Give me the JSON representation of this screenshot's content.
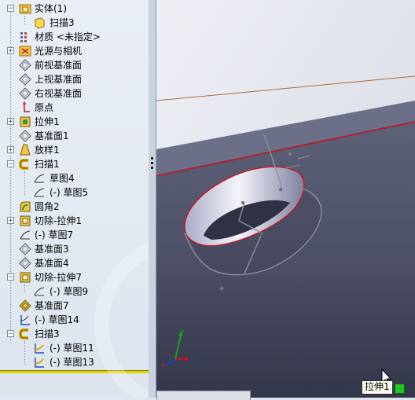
{
  "feature_tree": {
    "items": [
      {
        "label": "实体(1)",
        "icon": "solid-bodies-folder-icon",
        "expander": "−"
      },
      {
        "label": "扫描3",
        "icon": "solid-body-icon",
        "expander": ""
      },
      {
        "label": "材质 <未指定>",
        "icon": "material-icon",
        "expander": ""
      },
      {
        "label": "光源与相机",
        "icon": "lights-cameras-icon",
        "expander": "+"
      },
      {
        "label": "前视基准面",
        "icon": "plane-icon",
        "expander": ""
      },
      {
        "label": "上视基准面",
        "icon": "plane-icon",
        "expander": ""
      },
      {
        "label": "右视基准面",
        "icon": "plane-icon",
        "expander": ""
      },
      {
        "label": "原点",
        "icon": "origin-icon",
        "expander": ""
      },
      {
        "label": "拉伸1",
        "icon": "extrude-icon",
        "expander": "+"
      },
      {
        "label": "基准面1",
        "icon": "plane-icon",
        "expander": ""
      },
      {
        "label": "放样1",
        "icon": "loft-icon",
        "expander": "+"
      },
      {
        "label": "扫描1",
        "icon": "sweep-icon",
        "expander": "−"
      },
      {
        "label": "草图4",
        "icon": "sketch-icon",
        "expander": ""
      },
      {
        "label": "(-) 草图5",
        "icon": "sketch-icon",
        "expander": ""
      },
      {
        "label": "圆角2",
        "icon": "fillet-icon",
        "expander": ""
      },
      {
        "label": "切除-拉伸1",
        "icon": "cut-extrude-icon",
        "expander": "+"
      },
      {
        "label": "(-) 草图7",
        "icon": "sketch-icon",
        "expander": ""
      },
      {
        "label": "基准面3",
        "icon": "plane-icon",
        "expander": ""
      },
      {
        "label": "基准面4",
        "icon": "plane-icon",
        "expander": ""
      },
      {
        "label": "切除-拉伸7",
        "icon": "cut-extrude-icon",
        "expander": "−"
      },
      {
        "label": "(-) 草图9",
        "icon": "sketch-icon",
        "expander": ""
      },
      {
        "label": "基准面7",
        "icon": "plane-icon",
        "expander": ""
      },
      {
        "label": "(-) 草图14",
        "icon": "sketch-icon",
        "expander": ""
      },
      {
        "label": "扫描3",
        "icon": "sweep-icon",
        "expander": "−"
      },
      {
        "label": "(-) 草图11",
        "icon": "sketch-icon",
        "expander": ""
      },
      {
        "label": "(-) 草图13",
        "icon": "sketch-icon",
        "expander": ""
      }
    ]
  },
  "viewport": {
    "tooltip": "拉伸1",
    "bottom_tab_label": "",
    "triad_x": "X",
    "triad_y": "Y",
    "triad_z": "Z"
  },
  "colors": {
    "selection_edge": "#d01020",
    "tree_background": "#e6ebf2",
    "rollback_bar": "#e3d400",
    "status_indicator": "#22c522"
  }
}
